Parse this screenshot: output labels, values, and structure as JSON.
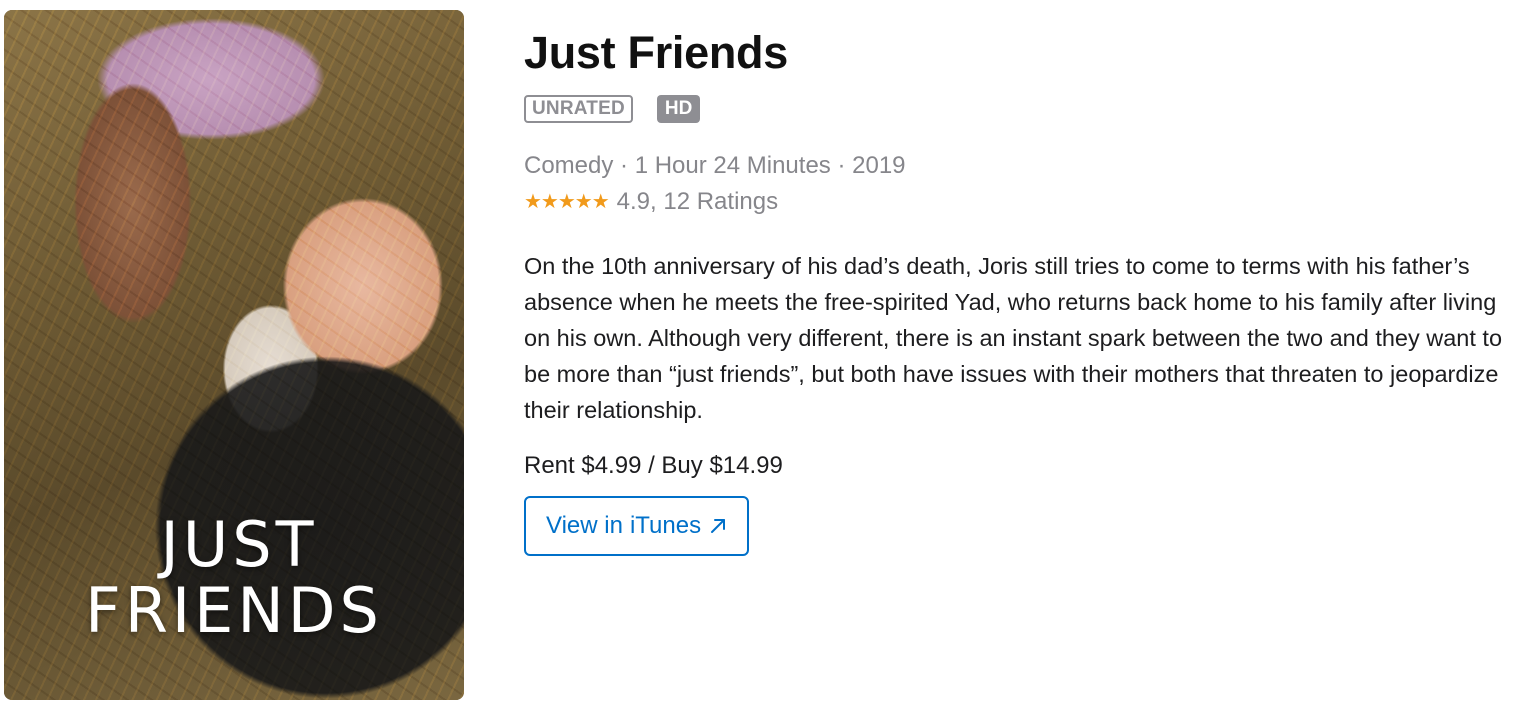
{
  "poster": {
    "title_line1": "JUST",
    "title_line2": "FRIENDS"
  },
  "movie": {
    "title": "Just Friends",
    "content_rating": "UNRATED",
    "quality_badge": "HD",
    "meta": "Comedy · 1 Hour 24 Minutes · 2019",
    "stars": "★★★★★",
    "rating_text": "4.9, 12 Ratings",
    "description": "On the 10th anniversary of his dad’s death, Joris still tries to come to terms with his father’s absence when he meets the free-spirited Yad, who returns back home to his family after living on his own. Although very different, there is an instant spark between the two and they want to be more than “just friends”, but both have issues with their mothers that threaten to jeopardize their relationship.",
    "price": "Rent $4.99 / Buy $14.99"
  },
  "button": {
    "label_prefix": "View in",
    "label_brand": "iTunes",
    "icon": "external-arrow-icon"
  },
  "colors": {
    "accent": "#0070c9",
    "stars": "#f19a1b",
    "secondary_text": "#86868b",
    "badge_gray": "#8e8e93"
  }
}
